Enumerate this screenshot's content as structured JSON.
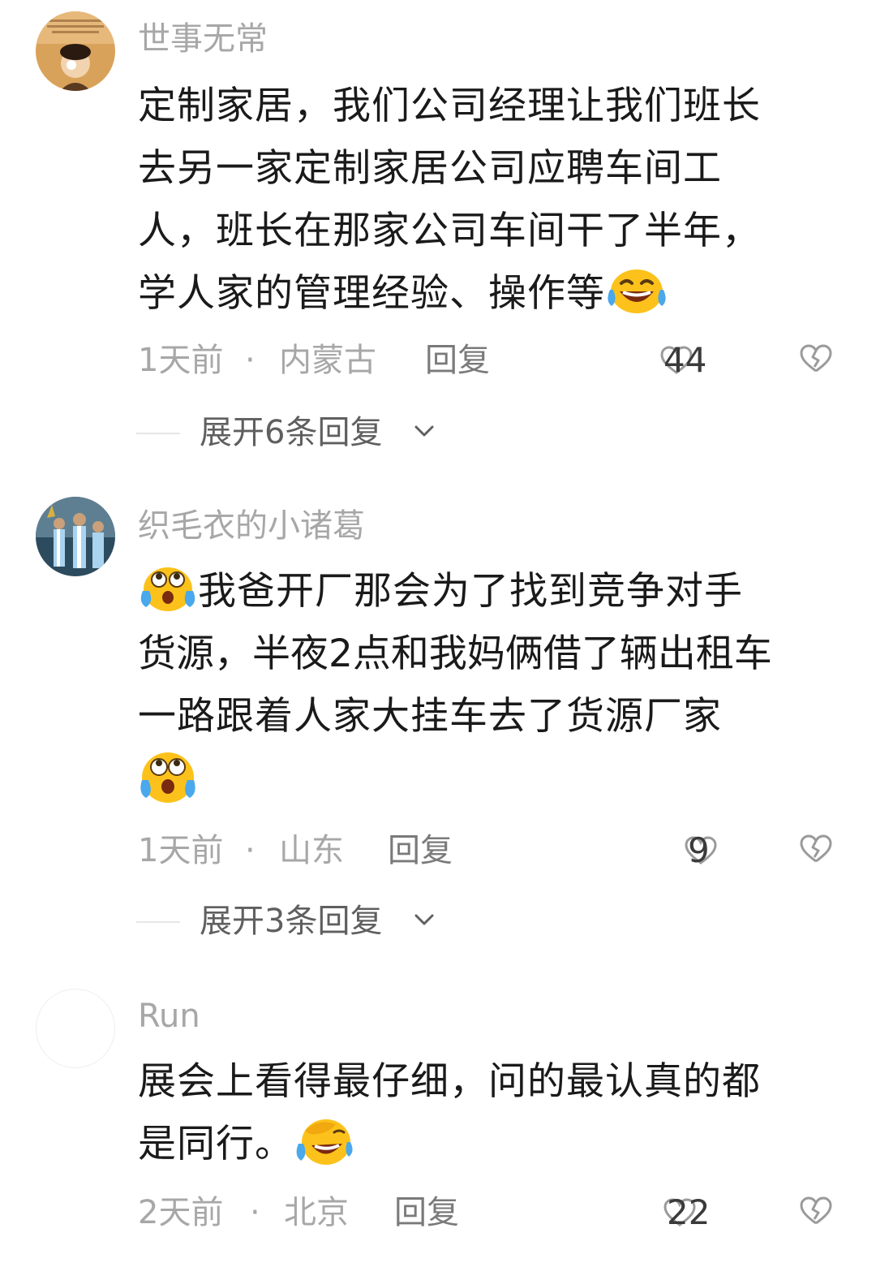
{
  "comments": [
    {
      "username": "世事无常",
      "lines": [
        "定制家居，我们公司经理让我们班长",
        "去另一家定制家居公司应聘车间工",
        "人，班长在那家公司车间干了半年，",
        "学人家的管理经验、操作等"
      ],
      "time": "1天前",
      "separator": "·",
      "location": "内蒙古",
      "reply_label": "回复",
      "likes": "44",
      "expand_label": "展开6条回复",
      "end_emoji": "laughing-tears-emoji"
    },
    {
      "username": "织毛衣的小诸葛",
      "lines": [
        "我爸开厂那会为了找到竞争对手",
        "货源，半夜2点和我妈俩借了辆出租车",
        "一路跟着人家大挂车去了货源厂家"
      ],
      "time": "1天前",
      "separator": "·",
      "location": "山东",
      "reply_label": "回复",
      "likes": "9",
      "expand_label": "展开3条回复",
      "start_emoji": "crying-up-emoji",
      "end_emoji": "crying-up-emoji"
    },
    {
      "username": "Run",
      "lines": [
        "展会上看得最仔细，问的最认真的都",
        "是同行。"
      ],
      "time": "2天前",
      "separator": "·",
      "location": "北京",
      "reply_label": "回复",
      "likes": "22",
      "end_emoji": "facepalm-laugh-emoji"
    }
  ],
  "colors": {
    "meta_gray": "#a7a7a7",
    "text": "#1a1a1a",
    "emoji_yellow": "#fcc21b",
    "tear_blue": "#4aa8ec"
  }
}
